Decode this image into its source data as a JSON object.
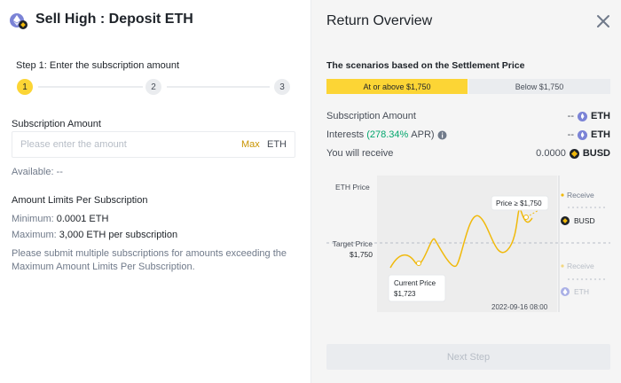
{
  "left": {
    "title": "Sell High : Deposit ETH",
    "title_icon": "eth-coin-icon",
    "step_label": "Step 1: Enter the subscription amount",
    "steps": [
      "1",
      "2",
      "3"
    ],
    "subscription_label": "Subscription Amount",
    "amount_placeholder": "Please enter the amount",
    "max_label": "Max",
    "unit": "ETH",
    "available": "Available: --",
    "limits_title": "Amount Limits Per Subscription",
    "min_label": "Minimum:",
    "min_value": "0.0001 ETH",
    "max_limit_label": "Maximum:",
    "max_value": "3,000 ETH per subscription",
    "note": "Please submit multiple subscriptions for amounts exceeding the Maximum Amount Limits Per Subscription."
  },
  "right": {
    "title": "Return Overview",
    "close_icon": "close-icon",
    "scenario_title": "The scenarios based on the Settlement Price",
    "tabs": [
      {
        "label": "At or above $1,750",
        "active": true
      },
      {
        "label": "Below $1,750",
        "active": false
      }
    ],
    "rows": {
      "sub_label": "Subscription Amount",
      "sub_value": "--",
      "sub_unit": "ETH",
      "int_label": "Interests",
      "int_apr": "(278.34%",
      "int_apr_suffix": "APR)",
      "int_value": "--",
      "int_unit": "ETH",
      "receive_label": "You will receive",
      "receive_value": "0.0000",
      "receive_unit": "BUSD"
    },
    "chart": {
      "eth_price": "ETH Price",
      "target_price": "Target Price",
      "target_value": "$1,750",
      "current_price": "Current Price",
      "current_value": "$1,723",
      "price_tag": "Price ≥ $1,750",
      "date": "2022-09-16 08:00",
      "receive_top": "Receive",
      "receive_top_unit": "BUSD",
      "receive_bottom": "Receive",
      "receive_bottom_unit": "ETH"
    },
    "next_step": "Next Step"
  }
}
